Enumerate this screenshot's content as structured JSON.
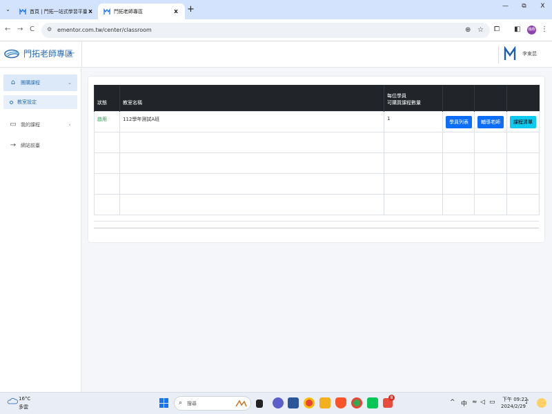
{
  "browser": {
    "tabs": [
      {
        "title": "首頁 | 門拓一站式學習平臺"
      },
      {
        "title": "門拓老師專區"
      }
    ],
    "url": "ementor.com.tw/center/classroom",
    "profile_label": "瑞燕"
  },
  "header": {
    "brand": "門拓老師專區",
    "user_name": "李東昆"
  },
  "sidebar": {
    "items": [
      {
        "label": "團購課程",
        "icon": "house-icon",
        "expanded": true
      },
      {
        "label": "教室設定",
        "icon": "circle-icon"
      },
      {
        "label": "我的課程",
        "icon": "book-icon"
      },
      {
        "label": "網站前臺",
        "icon": "arrow-right-icon"
      }
    ]
  },
  "table": {
    "columns": [
      "狀態",
      "教室名稱",
      "每位學員\n可購買課程數量",
      "",
      "",
      ""
    ],
    "rows": [
      {
        "status": "啟用",
        "name": "112學年測試A班",
        "quantity": "1",
        "actions": [
          "學員列表",
          "輔導老師",
          "課程清單"
        ]
      }
    ]
  },
  "taskbar": {
    "weather_temp": "16°C",
    "weather_cond": "多雲",
    "search_placeholder": "搜尋",
    "ime": "中",
    "time": "下午 09:22",
    "date": "2024/2/29",
    "line_badge": "8",
    "chrome_badge": "瑞燕"
  },
  "colors": {
    "brand": "#2f6fb3",
    "table_header": "#212529",
    "primary_button": "#0d6efd",
    "info_button": "#0dcaf0",
    "status_active": "#28a745"
  }
}
